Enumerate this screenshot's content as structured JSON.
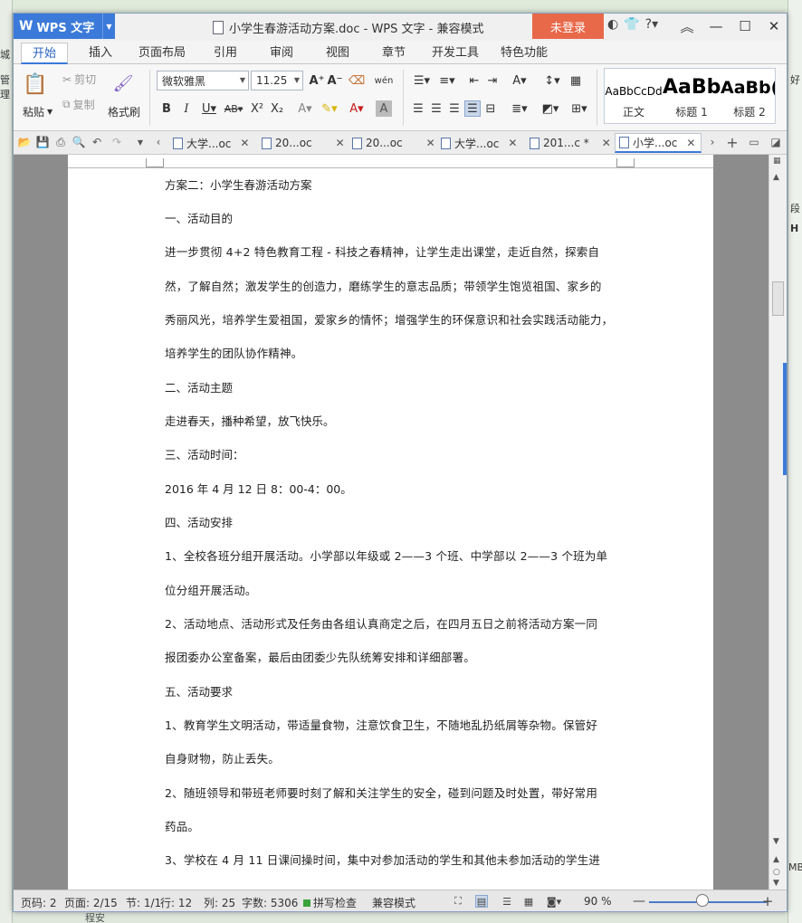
{
  "app": {
    "name": "WPS 文字",
    "doc_title": "小学生春游活动方案.doc - WPS 文字 - 兼容模式",
    "login_label": "未登录"
  },
  "ribbon_tabs": [
    "开始",
    "插入",
    "页面布局",
    "引用",
    "审阅",
    "视图",
    "章节",
    "开发工具",
    "特色功能"
  ],
  "ribbon": {
    "paste_label": "粘贴",
    "cut_label": "剪切",
    "copy_label": "复制",
    "format_painter_label": "格式刷",
    "font_name": "微软雅黑",
    "font_size": "11.25",
    "styles": [
      {
        "preview": "AaBbCcDd",
        "name": "正文"
      },
      {
        "preview": "AaBb",
        "name": "标题 1"
      },
      {
        "preview": "AaBb(",
        "name": "标题 2"
      }
    ]
  },
  "doc_tabs": [
    {
      "label": "大学...oc",
      "active": false
    },
    {
      "label": "20...oc",
      "active": false
    },
    {
      "label": "20...oc",
      "active": false
    },
    {
      "label": "大学...oc",
      "active": false
    },
    {
      "label": "201...c *",
      "active": false
    },
    {
      "label": "小学...oc",
      "active": true
    }
  ],
  "document": {
    "lines": [
      "方案二：小学生春游活动方案",
      "一、活动目的",
      "进一步贯彻 4+2 特色教育工程 - 科技之春精神，让学生走出课堂，走近自然，探索自",
      "然，了解自然；激发学生的创造力，磨练学生的意志品质；带领学生饱览祖国、家乡的",
      "秀丽风光，培养学生爱祖国，爱家乡的情怀；增强学生的环保意识和社会实践活动能力，",
      "培养学生的团队协作精神。",
      "二、活动主题",
      "走进春天，播种希望，放飞快乐。",
      "三、活动时间：",
      "2016 年 4 月 12 日 8：00-4：00。",
      "四、活动安排",
      "1、全校各班分组开展活动。小学部以年级或 2——3 个班、中学部以 2——3 个班为单",
      "位分组开展活动。",
      "2、活动地点、活动形式及任务由各组认真商定之后，在四月五日之前将活动方案一同",
      "报团委办公室备案，最后由团委少先队统筹安排和详细部署。",
      "五、活动要求",
      "1、教育学生文明活动，带适量食物，注意饮食卫生，不随地乱扔纸屑等杂物。保管好",
      "自身财物，防止丢失。",
      "2、随班领导和带班老师要时刻了解和关注学生的安全，碰到问题及时处置，带好常用",
      "药品。",
      "3、学校在 4 月 11 日课间操时间，集中对参加活动的学生和其他未参加活动的学生进"
    ]
  },
  "statusbar": {
    "page_num": "页码: 2",
    "pages": "页面: 2/15",
    "section": "节: 1/1",
    "row": "行: 12",
    "col": "列: 25",
    "word_count": "字数: 5306",
    "spell_check": "拼写检查",
    "compat_mode": "兼容模式",
    "zoom": "90 %"
  },
  "background": {
    "left_frags": [
      "城",
      "管理"
    ],
    "right_frags": [
      "好",
      "段",
      "H",
      "MB"
    ],
    "bottom_frag": "程安"
  }
}
